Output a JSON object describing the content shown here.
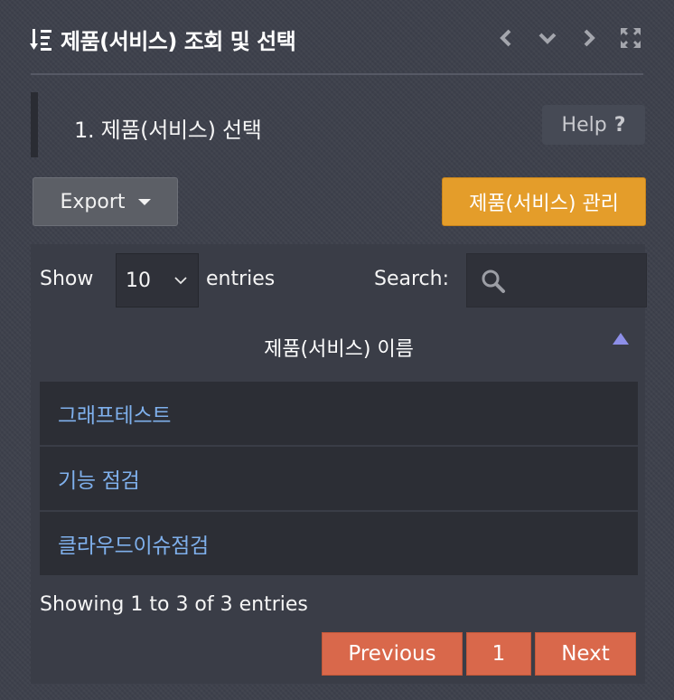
{
  "header": {
    "title": "제품(서비스) 조회 및 선택",
    "icons": [
      "sort-list-icon",
      "chevron-left-icon",
      "chevron-down-icon",
      "chevron-right-icon",
      "fullscreen-icon"
    ]
  },
  "step": {
    "title": "1. 제품(서비스) 선택",
    "help_label": "Help",
    "help_glyph": "?"
  },
  "toolbar": {
    "export_label": "Export",
    "manage_label": "제품(서비스) 관리"
  },
  "table_controls": {
    "show_label": "Show",
    "page_length": "10",
    "entries_label": "entries",
    "search_label": "Search:",
    "search_value": ""
  },
  "table": {
    "column_header": "제품(서비스) 이름",
    "rows": [
      "그래프테스트",
      "기능 점검",
      "클라우드이슈점검"
    ]
  },
  "footer": {
    "info": "Showing 1 to 3 of 3 entries",
    "prev_label": "Previous",
    "page_number": "1",
    "next_label": "Next"
  },
  "colors": {
    "background": "#3d404b",
    "accent_orange": "#e49d2a",
    "pager_red": "#d9684b",
    "link_blue": "#7fb0ec"
  }
}
